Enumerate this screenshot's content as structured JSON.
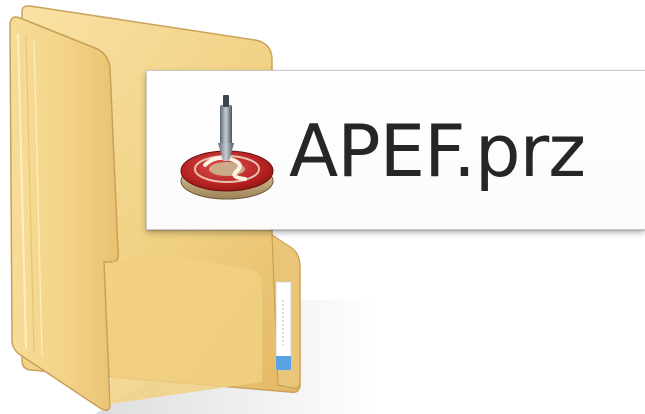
{
  "file": {
    "name": "APEF.prz",
    "icon": "app-file-icon"
  },
  "folder": {
    "icon": "folder-icon",
    "color": "#f2d48a"
  }
}
